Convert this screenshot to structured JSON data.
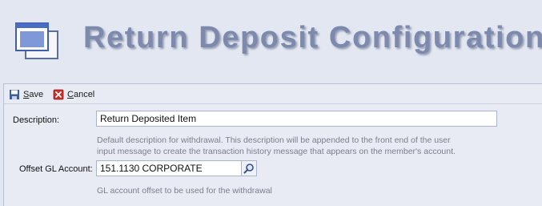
{
  "header": {
    "title": "Return Deposit Configuration",
    "icon": "window-icon"
  },
  "toolbar": {
    "save_label": "Save",
    "save_mnemonic": "S",
    "save_rest": "ave",
    "cancel_label": "Cancel",
    "cancel_mnemonic": "C",
    "cancel_rest": "ancel"
  },
  "form": {
    "description": {
      "label": "Description:",
      "value": "Return Deposited Item",
      "hint_line1": "Default description for withdrawal. This description will be appended to the front end of the user",
      "hint_line2": "input message to create the transaction history message that appears on the member's account."
    },
    "offset_gl": {
      "label": "Offset GL Account:",
      "value": "151.1130 CORPORATE",
      "hint": "GL account offset to be used for the withdrawal"
    }
  },
  "colors": {
    "background": "#e3e7f1",
    "title": "#7e8aad",
    "cancel_icon": "#c8302a",
    "save_icon": "#3d5f9c"
  }
}
